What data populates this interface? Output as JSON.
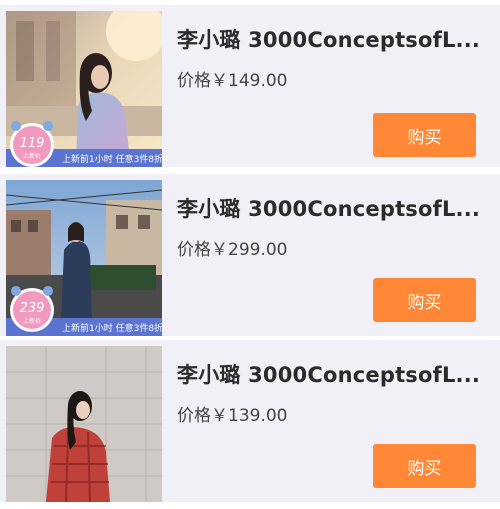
{
  "products": [
    {
      "title": "李小璐 3000ConceptsofL...",
      "price_label": "价格￥149.00",
      "buy_label": "购买",
      "badge_price": "119",
      "badge_sub": "上新价",
      "banner_text": "上新前1小时 任意3件8折"
    },
    {
      "title": "李小璐 3000ConceptsofL...",
      "price_label": "价格￥299.00",
      "buy_label": "购买",
      "badge_price": "239",
      "badge_sub": "上新价",
      "banner_text": "上新前1小时 任意3件8折"
    },
    {
      "title": "李小璐 3000ConceptsofL...",
      "price_label": "价格￥139.00",
      "buy_label": "购买"
    }
  ],
  "colors": {
    "card_bg": "#f1f0f6",
    "buy_button": "#ff8736",
    "banner_blue": "#4a66c8",
    "badge_pink": "#f19ac0"
  }
}
